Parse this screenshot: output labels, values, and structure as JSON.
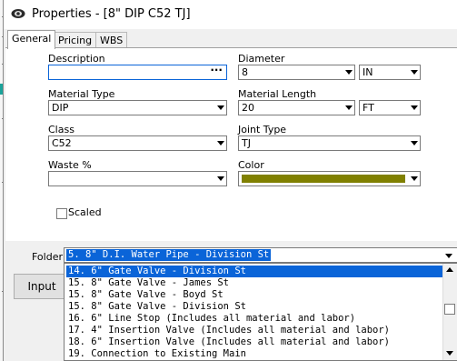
{
  "window": {
    "title": "Properties - [8\" DIP C52 TJ]"
  },
  "tabs": [
    {
      "label": "General",
      "active": true
    },
    {
      "label": "Pricing",
      "active": false
    },
    {
      "label": "WBS",
      "active": false
    }
  ],
  "form": {
    "description": {
      "label": "Description",
      "value": "",
      "button": "···"
    },
    "diameter": {
      "label": "Diameter",
      "value": "8",
      "unit": "IN"
    },
    "material_type": {
      "label": "Material Type",
      "value": "DIP"
    },
    "material_length": {
      "label": "Material Length",
      "value": "20",
      "unit": "FT"
    },
    "class": {
      "label": "Class",
      "value": "C52"
    },
    "joint_type": {
      "label": "Joint Type",
      "value": "TJ"
    },
    "waste": {
      "label": "Waste %",
      "value": ""
    },
    "color": {
      "label": "Color",
      "value": "#808000"
    },
    "scaled": {
      "label": "Scaled",
      "checked": false
    }
  },
  "folder": {
    "label": "Folder:",
    "selected": "5. 8\" D.I. Water Pipe - Division St",
    "options": [
      "14. 6\" Gate Valve - Division St",
      "15. 8\" Gate Valve - James St",
      "15. 8\" Gate Valve - Boyd St",
      "15. 8\" Gate Valve - Division St",
      "16. 6\" Line Stop (Includes all material and labor)",
      "17. 4\" Insertion Valve (Includes all material and labor)",
      "18. 6\" Insertion Valve (Includes all material and labor)",
      "19. Connection to Existing Main"
    ],
    "highlighted_index": 0
  },
  "buttons": {
    "input": "Input"
  },
  "colors": {
    "accent": "#0a64d8",
    "swatch": "#808000"
  }
}
